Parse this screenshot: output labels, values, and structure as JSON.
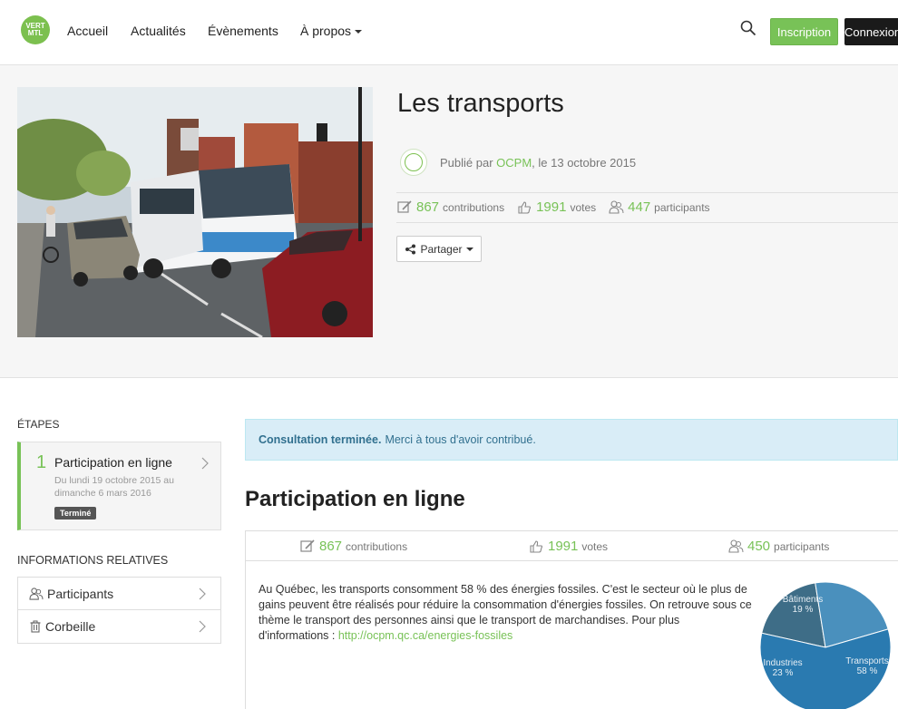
{
  "nav": {
    "logo_text": "VERT MTL",
    "links": [
      "Accueil",
      "Actualités",
      "Évènements",
      "À propos"
    ],
    "inscription": "Inscription",
    "connexion": "Connexion"
  },
  "project": {
    "title": "Les transports",
    "published_prefix": "Publié par",
    "author": "OCPM",
    "published_suffix": ", le 13 octobre 2015",
    "contributions": "867",
    "contributions_label": "contributions",
    "votes": "1991",
    "votes_label": "votes",
    "participants": "447",
    "participants_label": "participants",
    "share": "Partager"
  },
  "sidebar": {
    "etapes_title": "ÉTAPES",
    "step": {
      "number": "1",
      "label": "Participation en ligne",
      "dates": "Du lundi 19 octobre 2015 au dimanche 6 mars 2016",
      "badge": "Terminé"
    },
    "info_title": "INFORMATIONS RELATIVES",
    "info_items": [
      "Participants",
      "Corbeille"
    ]
  },
  "main": {
    "alert_bold": "Consultation terminée.",
    "alert_text": "Merci à tous d'avoir contribué.",
    "section_title": "Participation en ligne",
    "contributions": "867",
    "contributions_label": "contributions",
    "votes": "1991",
    "votes_label": "votes",
    "participants": "450",
    "participants_label": "participants",
    "description": "Au Québec, les transports consomment 58 % des énergies fossiles. C'est le secteur où le plus de gains peuvent être réalisés pour réduire la consommation d'énergies fossiles. On retrouve sous ce thème le transport des personnes ainsi que le transport de marchandises. Pour plus d'informations : ",
    "link": "http://ocpm.qc.ca/energies-fossiles"
  },
  "pie": {
    "slices": [
      {
        "label": "Bâtiments",
        "value": "19 %",
        "percent": 19,
        "color": "#3e6d87"
      },
      {
        "label": "Industries",
        "value": "23 %",
        "percent": 23,
        "color": "#4a90bd"
      },
      {
        "label": "Transports",
        "value": "58 %",
        "percent": 58,
        "color": "#2a7ab0"
      }
    ]
  },
  "colors": {
    "accent": "#78c257",
    "alert_bg": "#d9edf7",
    "alert_text": "#31708f"
  }
}
